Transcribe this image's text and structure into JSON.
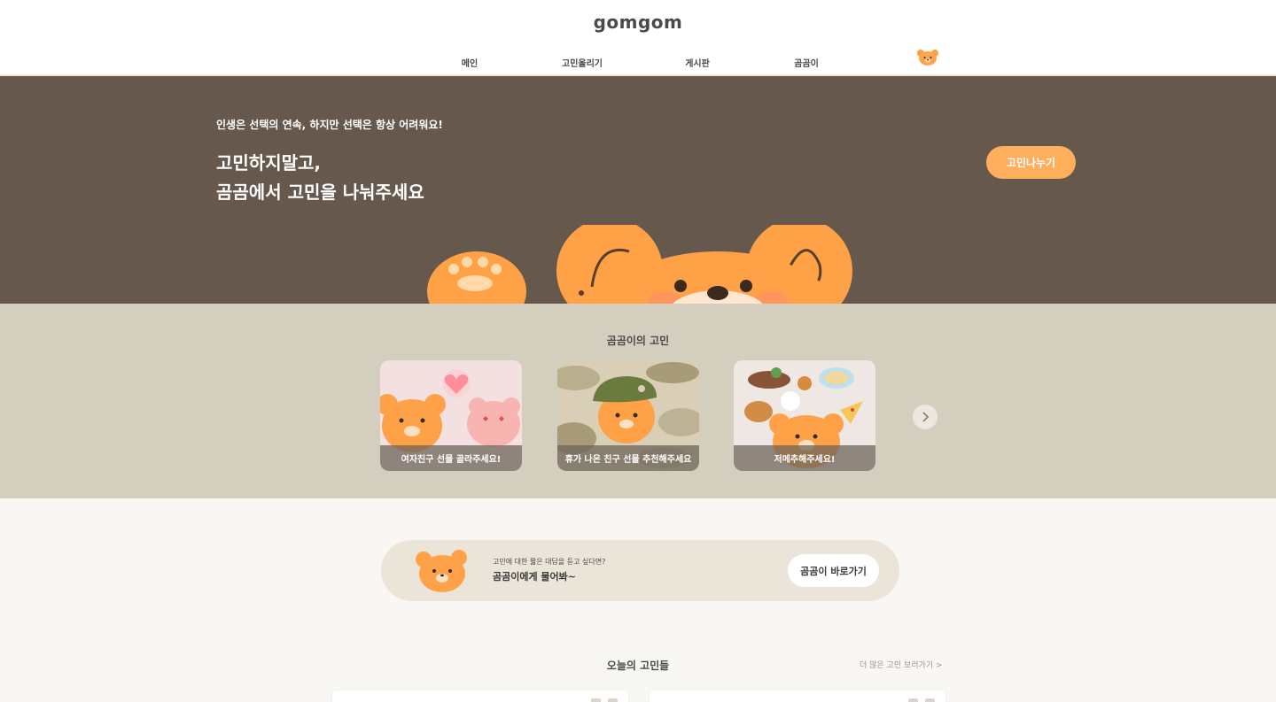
{
  "header": {
    "logo": "gomgom",
    "nav": [
      {
        "label": "메인"
      },
      {
        "label": "고민올리기"
      },
      {
        "label": "게시판"
      },
      {
        "label": "곰곰이"
      }
    ]
  },
  "hero": {
    "subtitle": "인생은 선택의 연속, 하지만 선택은 항상 어려워요!",
    "title_line1": "고민하지말고,",
    "title_line2": "곰곰에서 고민을 나눠주세요",
    "cta_label": "고민나누기"
  },
  "concerns": {
    "title": "곰곰이의 고민",
    "cards": [
      {
        "caption": "여자친구 선물 골라주세요!"
      },
      {
        "caption": "휴가 나온 친구 선물 추천해주세요"
      },
      {
        "caption": "저메추해주세요!"
      }
    ],
    "next_icon": "chevron-right-icon"
  },
  "ask": {
    "small_text": "고민에 대한 짧은 대답을 듣고 싶다면?",
    "main_text": "곰곰이에게 물어봐~",
    "button_label": "곰곰이 바로가기"
  },
  "today": {
    "title": "오늘의 고민들",
    "more_link": "더 많은 고민 보러가기 >"
  },
  "colors": {
    "hero_bg": "#66584c",
    "concerns_bg": "#d4cebf",
    "accent": "#ffae5c",
    "page_bg": "#f8f7f3"
  }
}
